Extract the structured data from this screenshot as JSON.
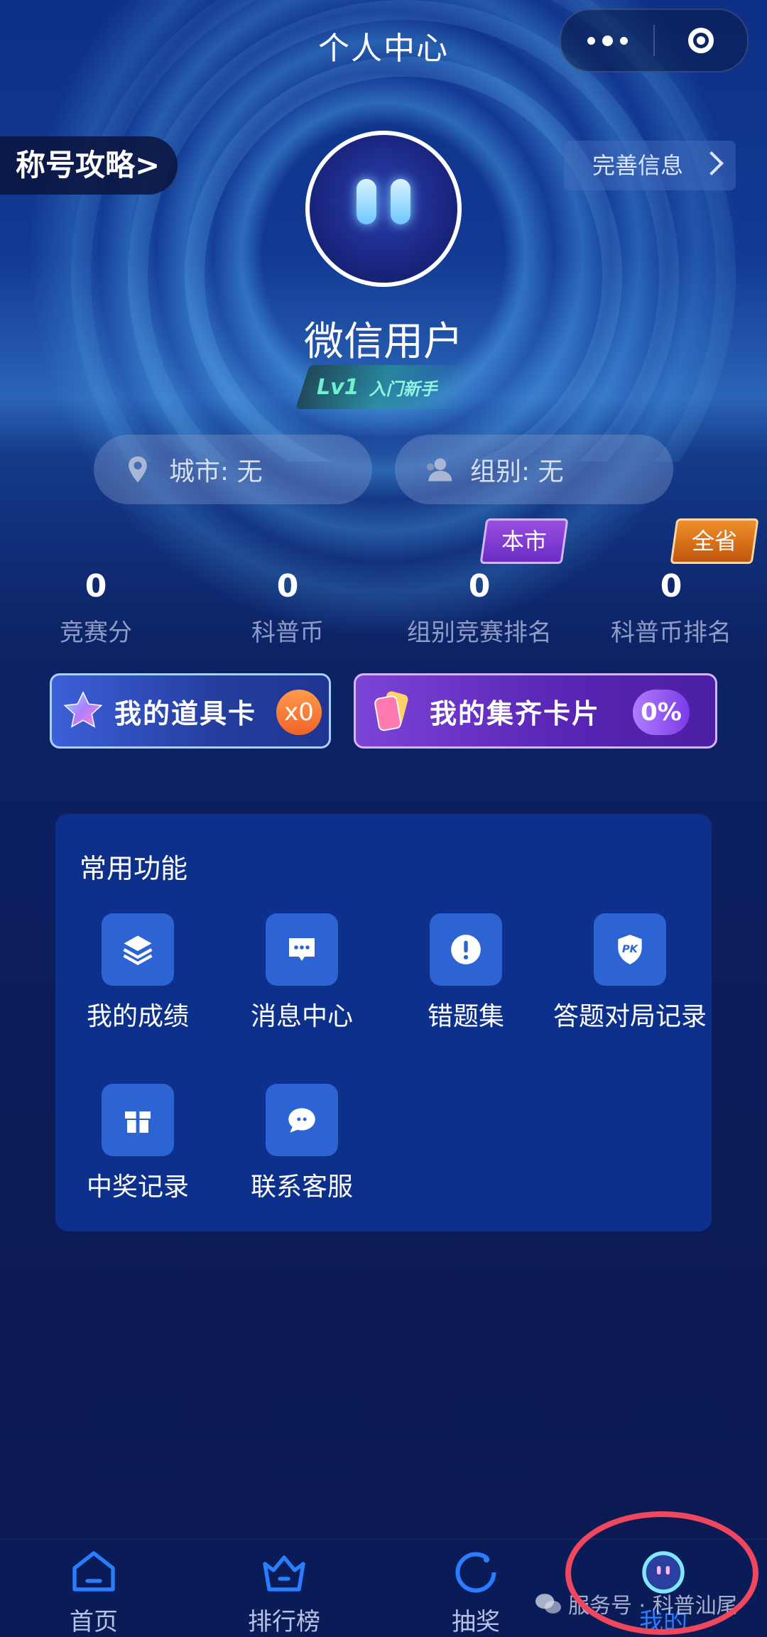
{
  "header": {
    "title": "个人中心"
  },
  "capsule": {
    "more_icon": "more-dots-icon",
    "close_icon": "target-close-icon"
  },
  "title_strategy": {
    "label": "称号攻略>"
  },
  "complete_info": {
    "label": "完善信息"
  },
  "profile": {
    "name": "微信用户",
    "level": "Lv1",
    "rank_title": "入门新手"
  },
  "info_pills": [
    {
      "label": "城市: 无",
      "icon": "location-pin-icon"
    },
    {
      "label": "组别: 无",
      "icon": "user-group-icon"
    }
  ],
  "tags": {
    "city": "本市",
    "province": "全省"
  },
  "stats": [
    {
      "value": "0",
      "label": "竞赛分"
    },
    {
      "value": "0",
      "label": "科普币"
    },
    {
      "value": "0",
      "label": "组别竞赛排名"
    },
    {
      "value": "0",
      "label": "科普币排名"
    }
  ],
  "cards": {
    "props": {
      "label": "我的道具卡",
      "count": "x0"
    },
    "collect": {
      "label": "我的集齐卡片",
      "percent": "0%"
    }
  },
  "functions": {
    "title": "常用功能",
    "items": [
      {
        "label": "我的成绩",
        "icon": "layers-icon"
      },
      {
        "label": "消息中心",
        "icon": "message-icon"
      },
      {
        "label": "错题集",
        "icon": "exclamation-icon"
      },
      {
        "label": "答题对局记录",
        "icon": "pk-shield-icon"
      },
      {
        "label": "中奖记录",
        "icon": "gift-icon"
      },
      {
        "label": "联系客服",
        "icon": "chat-bubble-icon"
      }
    ]
  },
  "tabbar": [
    {
      "label": "首页",
      "icon": "home-icon"
    },
    {
      "label": "排行榜",
      "icon": "crown-icon"
    },
    {
      "label": "抽奖",
      "icon": "lottery-icon"
    },
    {
      "label": "我的",
      "icon": "profile-face-icon",
      "active": true
    }
  ],
  "watermark": {
    "text": "服务号 · 科普汕尾"
  },
  "colors": {
    "accent": "#2a7dff",
    "highlight": "#f0465e",
    "panel": "#0d308c"
  }
}
